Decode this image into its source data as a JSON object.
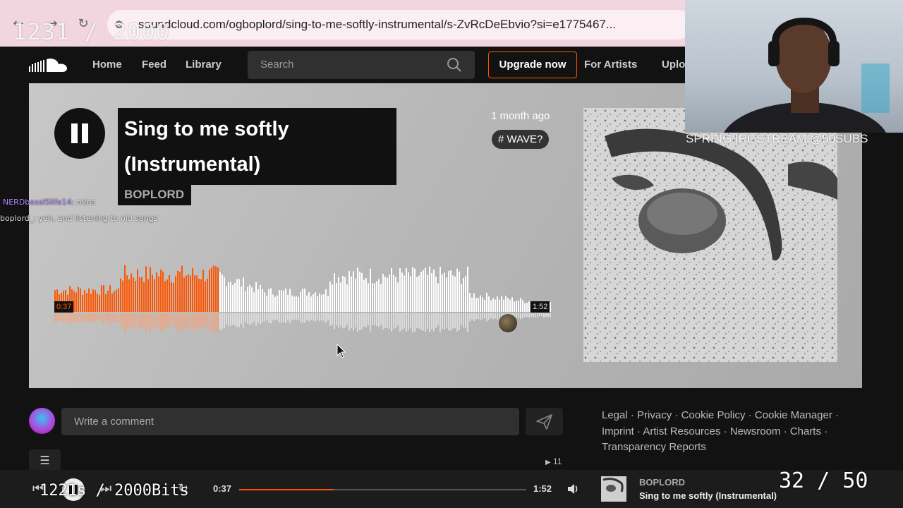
{
  "browser": {
    "url": "soundcloud.com/ogboplord/sing-to-me-softly-instrumental/s-ZvRcDeEbvio?si=e1775467..."
  },
  "overlays": {
    "counter": "1231 / 2000",
    "bits": "1221s / 2000Bits",
    "subs": "32 / 50",
    "stream_label": "SPRING IRL STREAM @50SUBS",
    "chat": [
      {
        "user": "NERDbassISlife14:",
        "message": "mins"
      },
      {
        "user": "boplord_:",
        "message": "yeh, and listening to old songs"
      }
    ]
  },
  "header": {
    "nav": [
      "Home",
      "Feed",
      "Library"
    ],
    "search_placeholder": "Search",
    "upgrade_label": "Upgrade now",
    "for_artists": "For Artists",
    "upload": "Upload"
  },
  "track": {
    "title_line1": "Sing to me softly",
    "title_line2": "(Instrumental)",
    "artist": "BOPLORD",
    "posted": "1 month ago",
    "tag": "# WAVE?",
    "current_time": "0:37",
    "duration": "1:52",
    "progress": 0.33
  },
  "comment": {
    "placeholder": "Write a comment"
  },
  "footer": {
    "links": [
      "Legal",
      "Privacy",
      "Cookie Policy",
      "Cookie Manager",
      "Imprint",
      "Artist Resources",
      "Newsroom",
      "Charts",
      "Transparency Reports"
    ]
  },
  "stats": {
    "plays": "11"
  },
  "player": {
    "current_time": "0:37",
    "duration": "1:52",
    "artist": "BOPLORD",
    "title": "Sing to me softly (Instrumental)",
    "progress": 0.33
  },
  "colors": {
    "accent": "#ff5500",
    "background": "#121212"
  }
}
